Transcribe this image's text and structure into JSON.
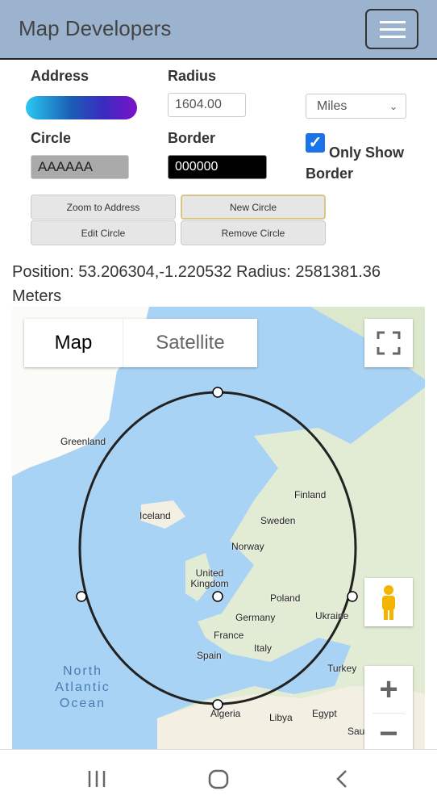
{
  "header": {
    "title": "Map Developers",
    "menu_icon": "hamburger-icon"
  },
  "form": {
    "address_label": "Address",
    "radius_label": "Radius",
    "radius_value": "1604.00",
    "unit_selected": "Miles",
    "circle_label": "Circle",
    "circle_color": "AAAAAA",
    "border_label": "Border",
    "border_color": "000000",
    "only_show_border_label": "Only Show Border",
    "only_show_border_checked": true,
    "buttons": [
      "Zoom to Address",
      "New Circle",
      "Edit Circle",
      "Remove Circle"
    ]
  },
  "position_text": "Position: 53.206304,-1.220532 Radius: 2581381.36 Meters",
  "map": {
    "type_tabs": [
      "Map",
      "Satellite"
    ],
    "selected_tab": "Map",
    "labels": [
      "Greenland",
      "Iceland",
      "Finland",
      "Sweden",
      "Norway",
      "United Kingdom",
      "Poland",
      "Germany",
      "Ukraine",
      "France",
      "Italy",
      "Spain",
      "Turkey",
      "North Atlantic Ocean",
      "Algeria",
      "Libya",
      "Egypt",
      "Sau"
    ],
    "zoom_in": "+",
    "zoom_out": "−"
  },
  "colors": {
    "header": "#9bb3cf",
    "water": "#a9d3f5",
    "land": "#f3efe2",
    "circle_border": "#000000"
  }
}
